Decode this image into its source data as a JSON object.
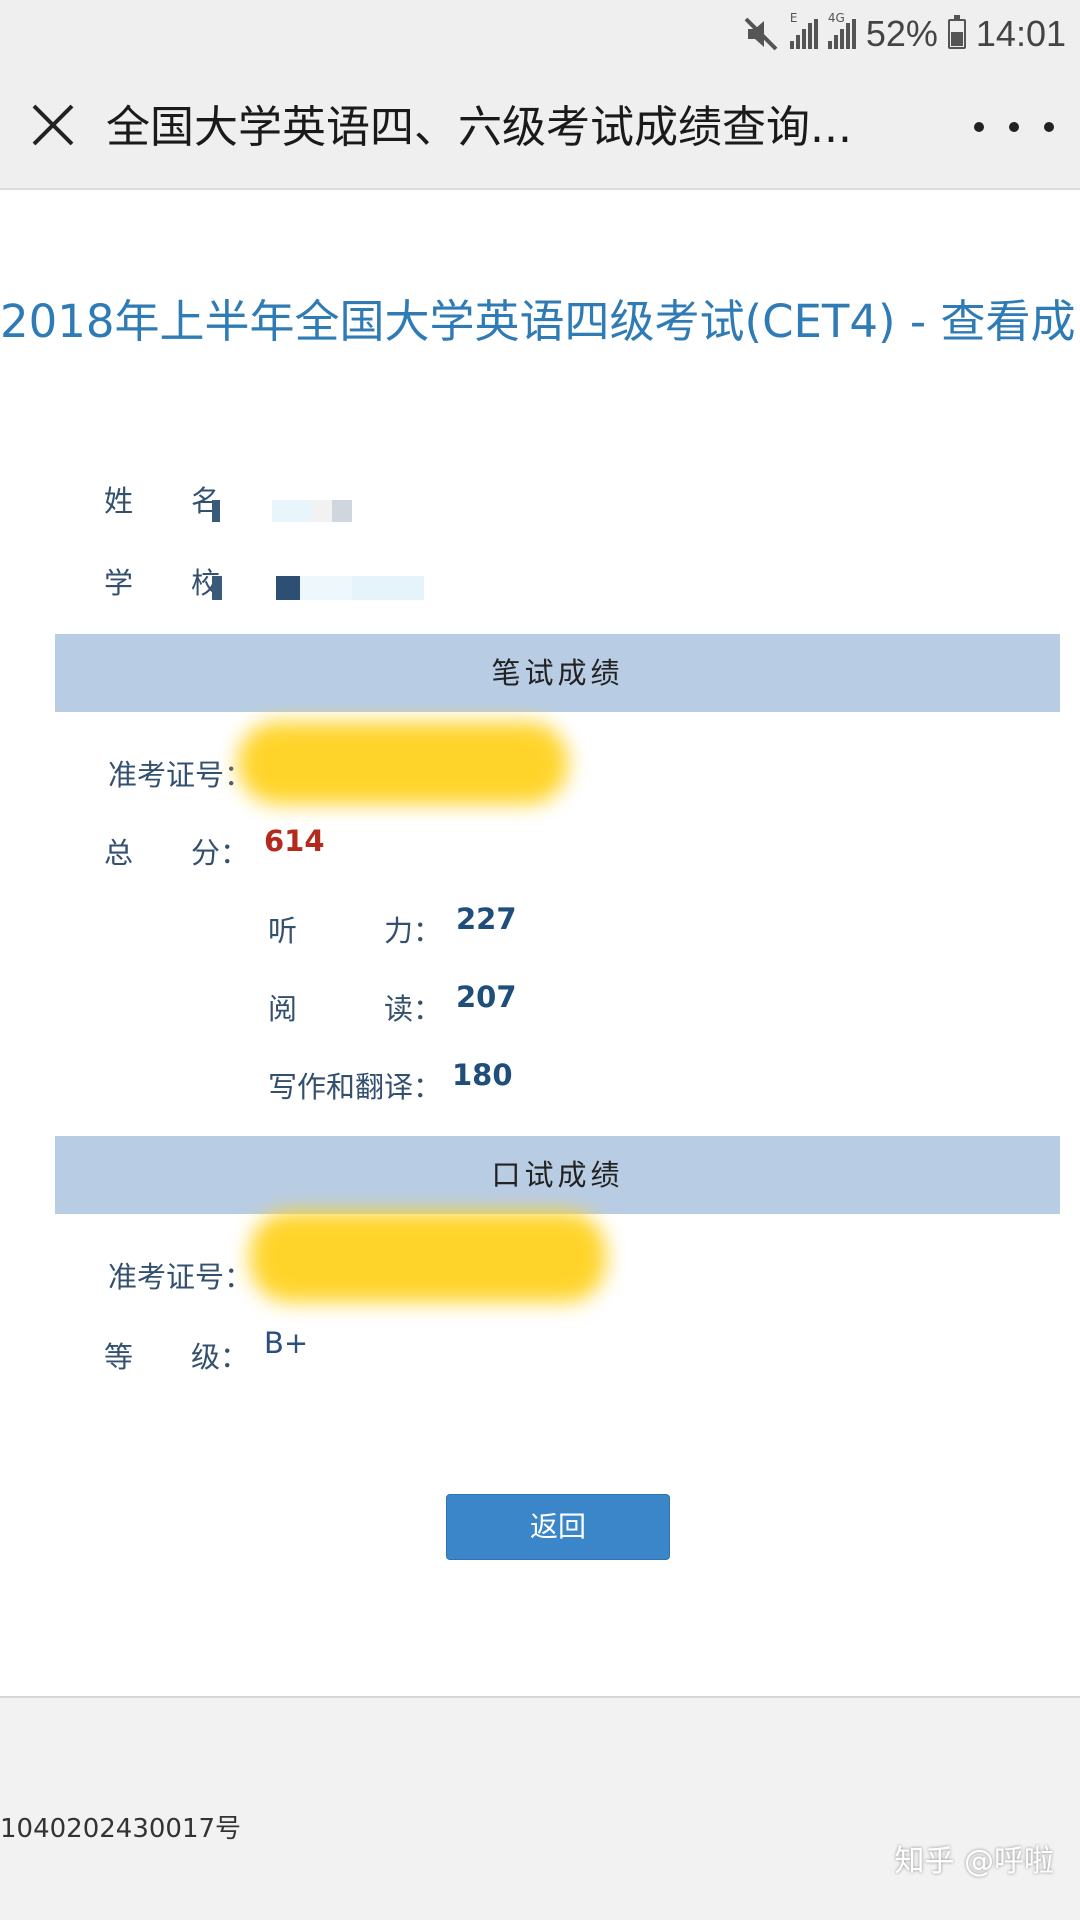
{
  "status_bar": {
    "battery_percent": "52%",
    "time": "14:01",
    "network_labels": [
      "E",
      "4G"
    ],
    "icons": [
      "mute-icon",
      "signal-icon",
      "signal-icon",
      "battery-icon"
    ]
  },
  "nav": {
    "title": "全国大学英语四、六级考试成绩查询...",
    "close_icon": "close-icon",
    "more_icon": "more-icon"
  },
  "page": {
    "title": "2018年上半年全国大学英语四级考试(CET4) - 查看成",
    "name_label": "姓　　名",
    "school_label": "学　　校",
    "written_section": "笔试成绩",
    "written_ticket_label": "准考证号：",
    "total_label": "总　　分：",
    "total_score": "614",
    "listening_label": "听　　　力：",
    "listening_score": "227",
    "reading_label": "阅　　　读：",
    "reading_score": "207",
    "writing_label": "写作和翻译：",
    "writing_score": "180",
    "oral_section": "口试成绩",
    "oral_ticket_label": "准考证号：",
    "grade_label": "等　　级：",
    "grade": "B+",
    "back_button": "返回"
  },
  "footer": {
    "text": "1040202430017号",
    "watermark": "知乎 @呼啦"
  },
  "colors": {
    "accent": "#2f7bb6",
    "section_bar": "#b8cce4",
    "total_score": "#b42a1d",
    "score": "#1f4e7a",
    "button": "#3a86c9",
    "highlight": "#ffd21f"
  }
}
